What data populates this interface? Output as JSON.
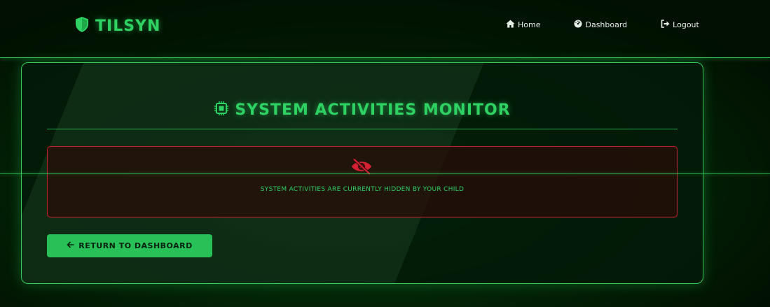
{
  "brand": {
    "name": "TILSYN",
    "icon": "shield-icon",
    "accent": "#2ed162"
  },
  "nav": {
    "items": [
      {
        "label": "Home",
        "icon": "home-icon"
      },
      {
        "label": "Dashboard",
        "icon": "gauge-icon"
      },
      {
        "label": "Logout",
        "icon": "logout-icon"
      }
    ]
  },
  "monitor": {
    "title": "SYSTEM ACTIVITIES MONITOR",
    "title_icon": "cpu-icon",
    "alert": {
      "icon": "eye-slash-icon",
      "message": "SYSTEM ACTIVITIES ARE CURRENTLY HIDDEN BY YOUR CHILD",
      "border_color": "#c8202a"
    },
    "return_button": {
      "label": "RETURN TO DASHBOARD",
      "icon": "arrow-left-icon"
    }
  }
}
